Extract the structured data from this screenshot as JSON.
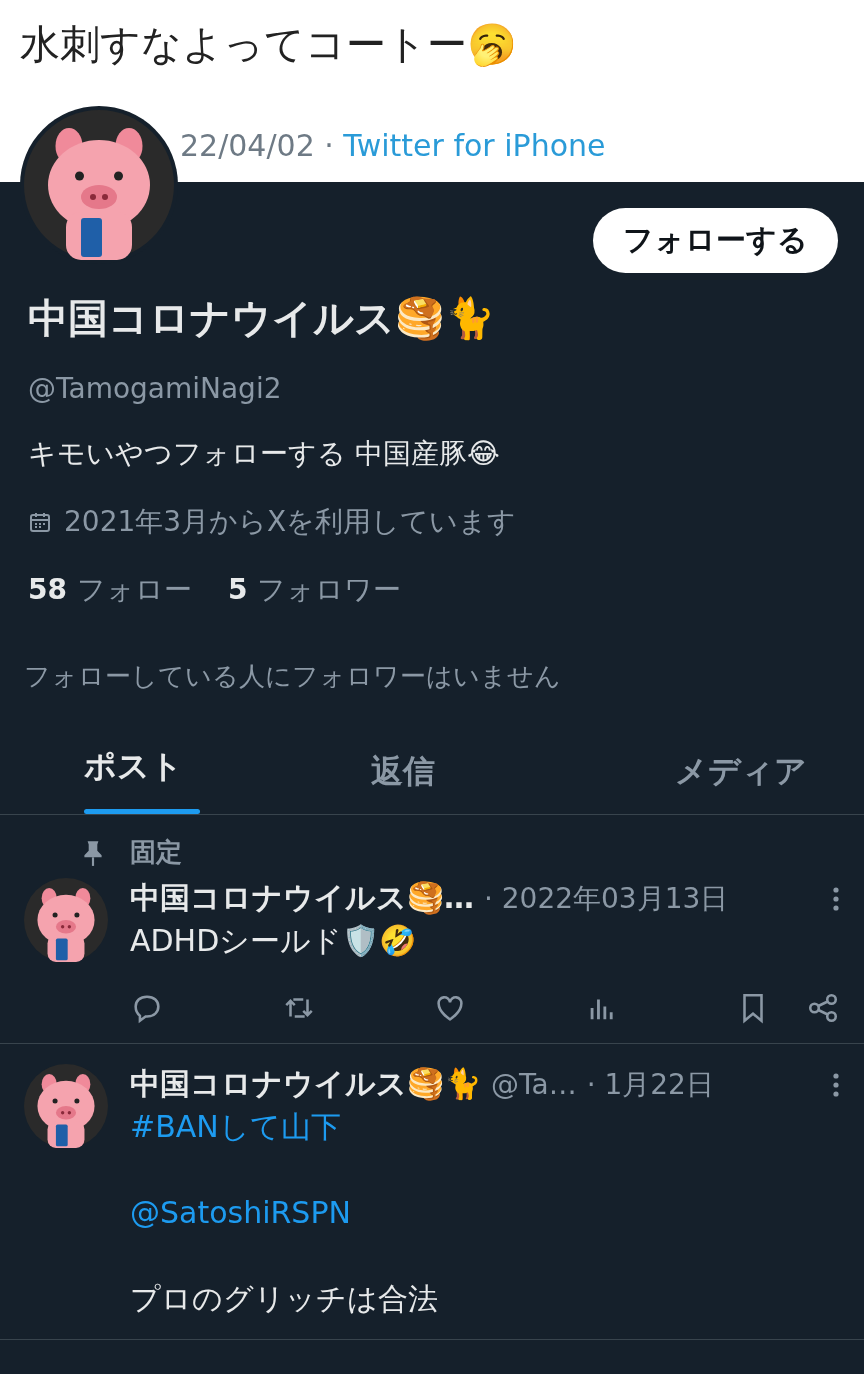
{
  "background_tweet": {
    "text": "水刺すなよってコートー🥱",
    "date": "22/04/02 · ",
    "source": "Twitter for iPhone"
  },
  "profile": {
    "follow_button": "フォローする",
    "name": "中国コロナウイルス🥞🐈",
    "handle": "@TamogamiNagi2",
    "bio": "キモいやつフォローする 中国産豚😂",
    "joined": "2021年3月からXを利用しています",
    "following_count": "58",
    "following_label": "フォロー",
    "followers_count": "5",
    "followers_label": "フォロワー",
    "followers_you_know": "フォローしている人にフォロワーはいません"
  },
  "tabs": [
    {
      "label": "ポスト",
      "selected": true
    },
    {
      "label": "返信",
      "selected": false
    },
    {
      "label": "メディア",
      "selected": false
    }
  ],
  "posts": [
    {
      "pinned_label": "固定",
      "name": "中国コロナウイルス🥞…",
      "date": "· 2022年03月13日",
      "actions_visible": true,
      "paragraphs": [
        {
          "kind": "text",
          "text": "ADHDシールド🛡️🤣"
        }
      ]
    },
    {
      "name": "中国コロナウイルス🥞🐈",
      "handle": "@Ta…",
      "date": "· 1月22日",
      "actions_visible": false,
      "paragraphs": [
        {
          "kind": "link",
          "text": "#BANして山下"
        },
        {
          "kind": "link",
          "text": "@SatoshiRSPN"
        },
        {
          "kind": "text",
          "text": "プロのグリッチは合法"
        }
      ]
    }
  ]
}
